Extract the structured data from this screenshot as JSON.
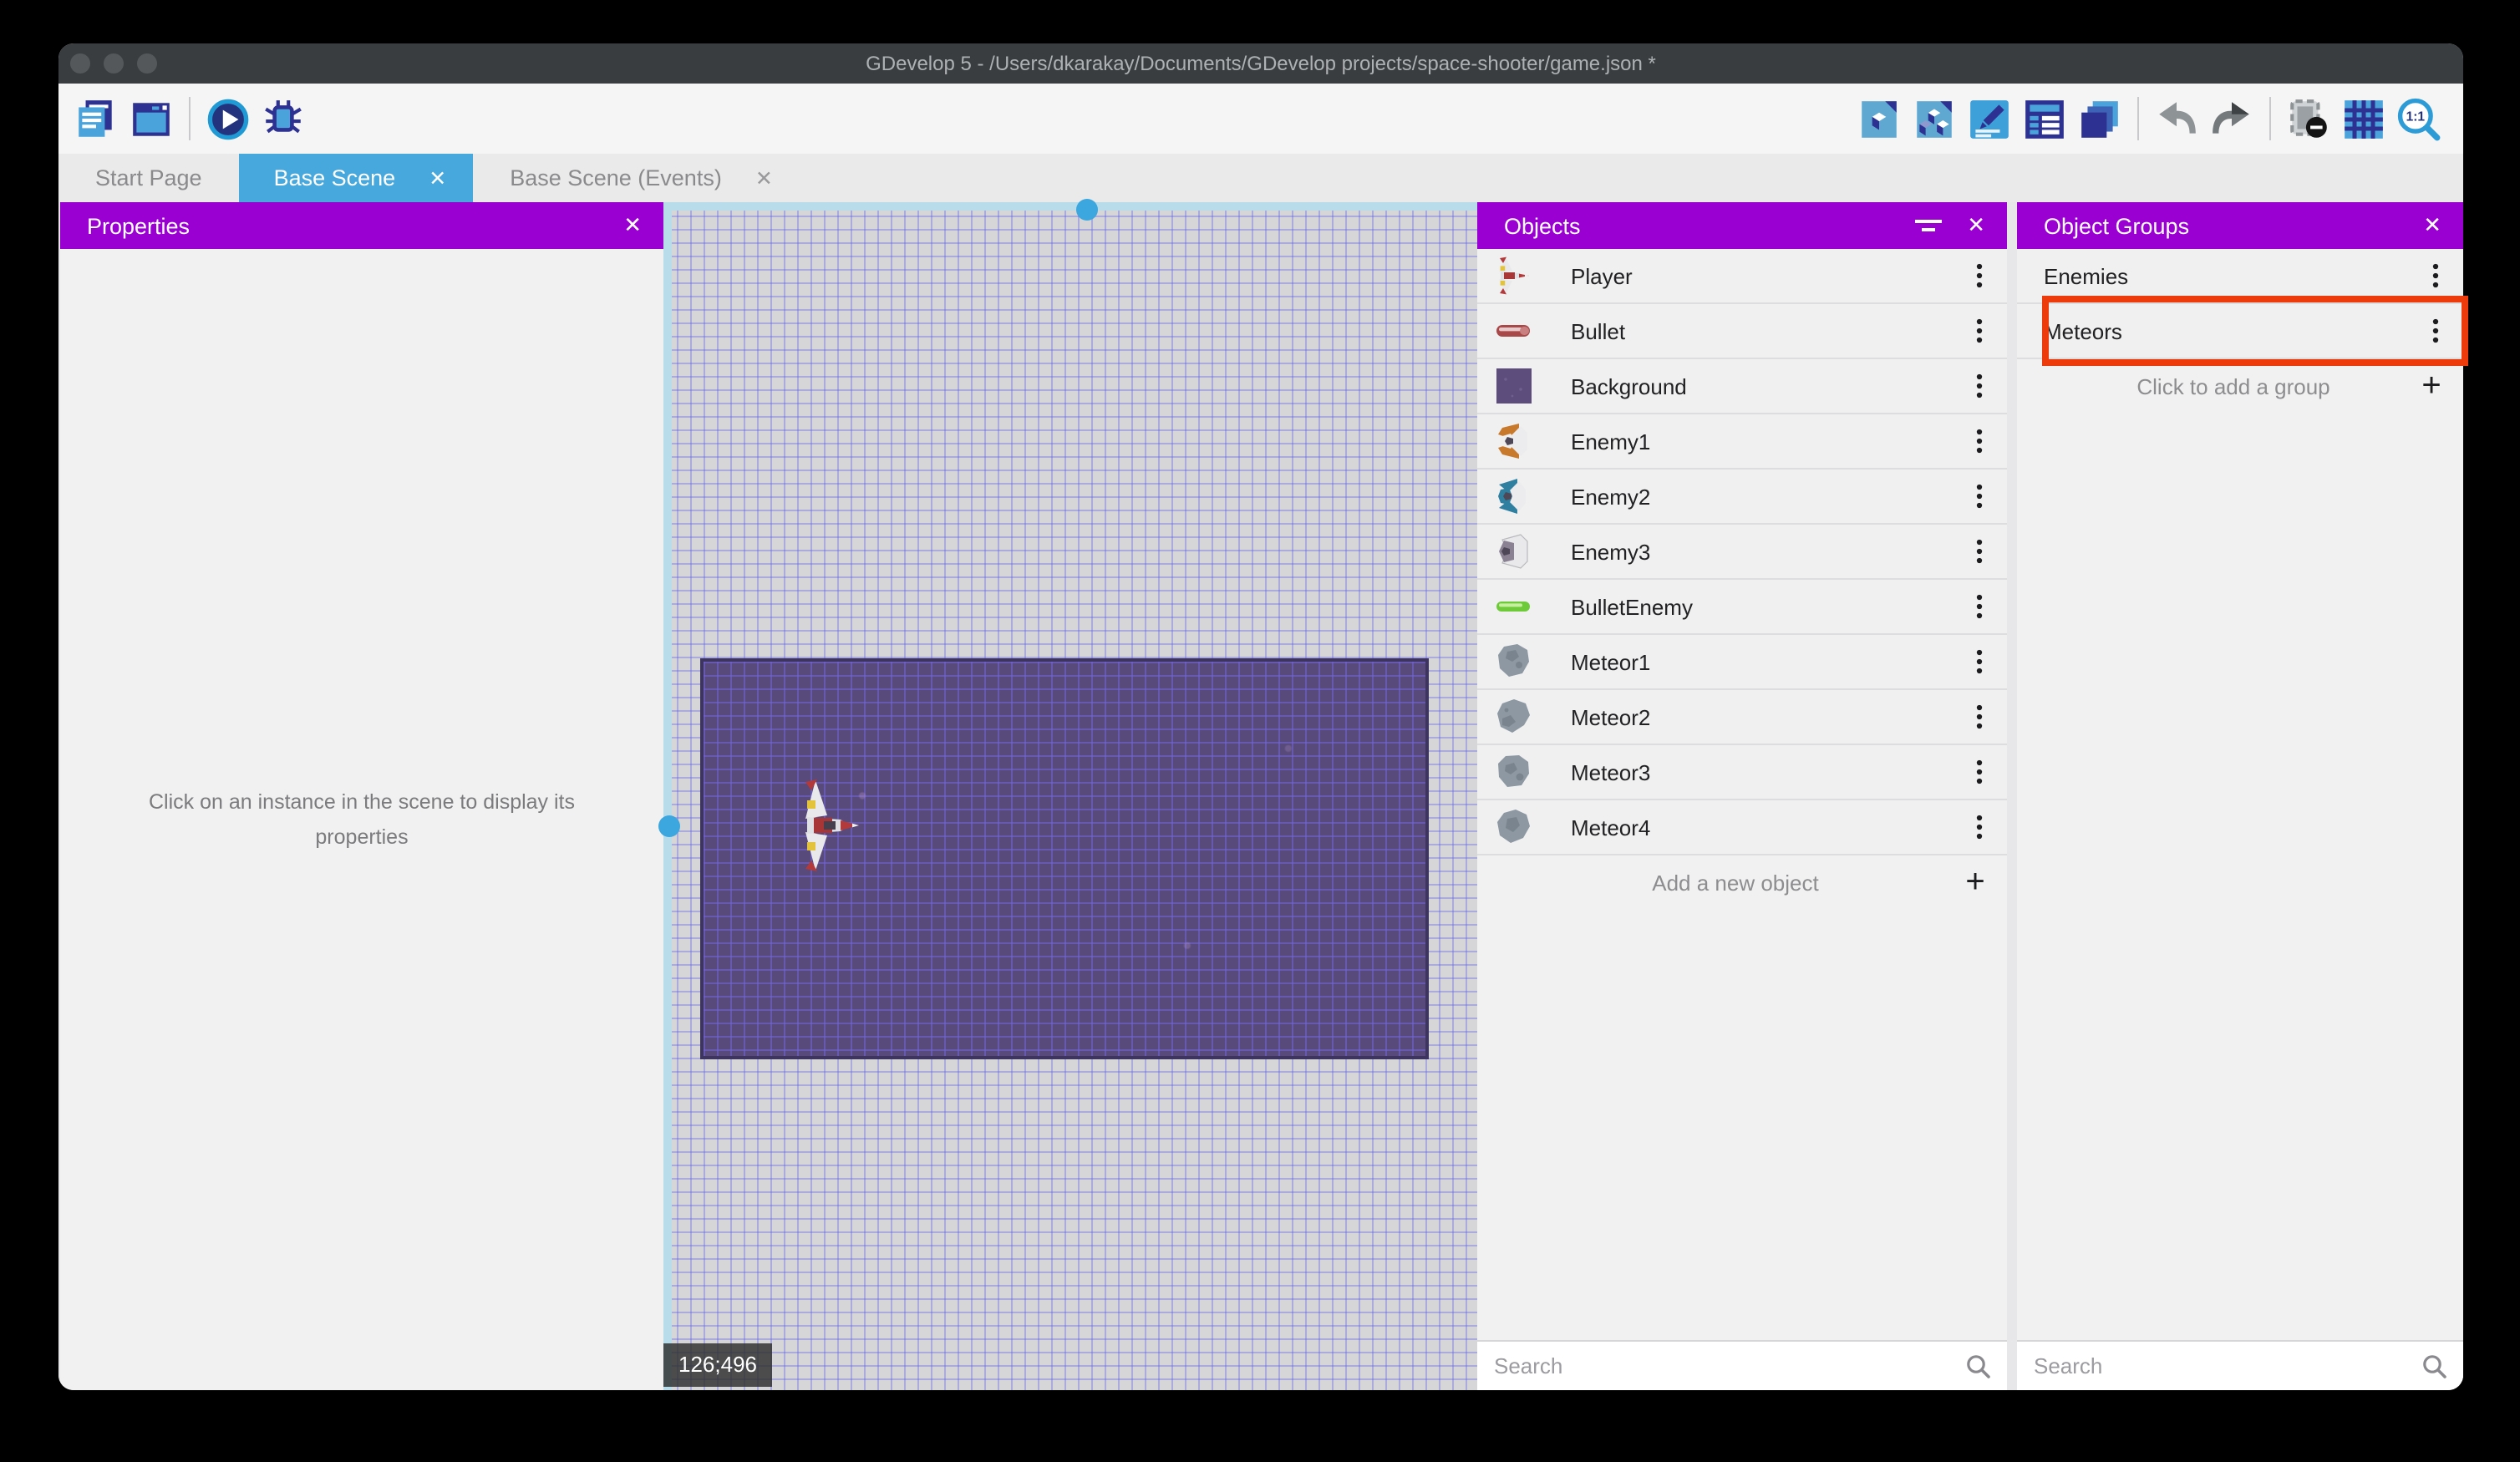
{
  "window": {
    "title": "GDevelop 5 - /Users/dkarakay/Documents/GDevelop projects/space-shooter/game.json *"
  },
  "toolbar": {
    "left": [
      {
        "name": "project-manager-button",
        "icon": "pages"
      },
      {
        "name": "start-page-window-button",
        "icon": "window"
      },
      {
        "name": "separator"
      },
      {
        "name": "launch-preview-button",
        "icon": "play"
      },
      {
        "name": "debug-button",
        "icon": "bug"
      }
    ],
    "right": [
      {
        "name": "open-objects-editor-button",
        "icon": "doccube"
      },
      {
        "name": "open-object-groups-editor-button",
        "icon": "doccubes"
      },
      {
        "name": "open-properties-button",
        "icon": "edit"
      },
      {
        "name": "open-instances-list-button",
        "icon": "listform"
      },
      {
        "name": "open-layers-editor-button",
        "icon": "layers"
      },
      {
        "name": "separator"
      },
      {
        "name": "undo-button",
        "icon": "undo"
      },
      {
        "name": "redo-button",
        "icon": "redo"
      },
      {
        "name": "separator"
      },
      {
        "name": "toggle-window-mask-button",
        "icon": "mask"
      },
      {
        "name": "toggle-grid-button",
        "icon": "grid"
      },
      {
        "name": "zoom-original-button",
        "icon": "oneone"
      }
    ]
  },
  "tabs": [
    {
      "label": "Start Page",
      "active": false,
      "closable": false
    },
    {
      "label": "Base Scene",
      "active": true,
      "closable": true
    },
    {
      "label": "Base Scene (Events)",
      "active": false,
      "closable": true
    }
  ],
  "properties_panel": {
    "title": "Properties",
    "message": "Click on an instance in the scene to display its properties"
  },
  "scene": {
    "coordinates": "126;496"
  },
  "objects_panel": {
    "title": "Objects",
    "items": [
      {
        "label": "Player",
        "icon": "shipmini"
      },
      {
        "label": "Bullet",
        "icon": "bulletred"
      },
      {
        "label": "Background",
        "icon": "bgsquare"
      },
      {
        "label": "Enemy1",
        "icon": "enemy1"
      },
      {
        "label": "Enemy2",
        "icon": "enemy2"
      },
      {
        "label": "Enemy3",
        "icon": "enemy3"
      },
      {
        "label": "BulletEnemy",
        "icon": "bulletgreen"
      },
      {
        "label": "Meteor1",
        "icon": "meteor1"
      },
      {
        "label": "Meteor2",
        "icon": "meteor2"
      },
      {
        "label": "Meteor3",
        "icon": "meteor3"
      },
      {
        "label": "Meteor4",
        "icon": "meteor4"
      }
    ],
    "add_label": "Add a new object",
    "search_placeholder": "Search"
  },
  "object_groups_panel": {
    "title": "Object Groups",
    "items": [
      {
        "label": "Enemies",
        "highlighted": false
      },
      {
        "label": "Meteors",
        "highlighted": true
      }
    ],
    "add_label": "Click to add a group",
    "search_placeholder": "Search"
  },
  "colors": {
    "panel_header_purple": "#9a00d2",
    "active_tab_blue": "#47a8dd",
    "annotation_red": "#ee3b0c",
    "toolbar_navy": "#2d3192",
    "toolbar_blue": "#4ba3dc"
  }
}
